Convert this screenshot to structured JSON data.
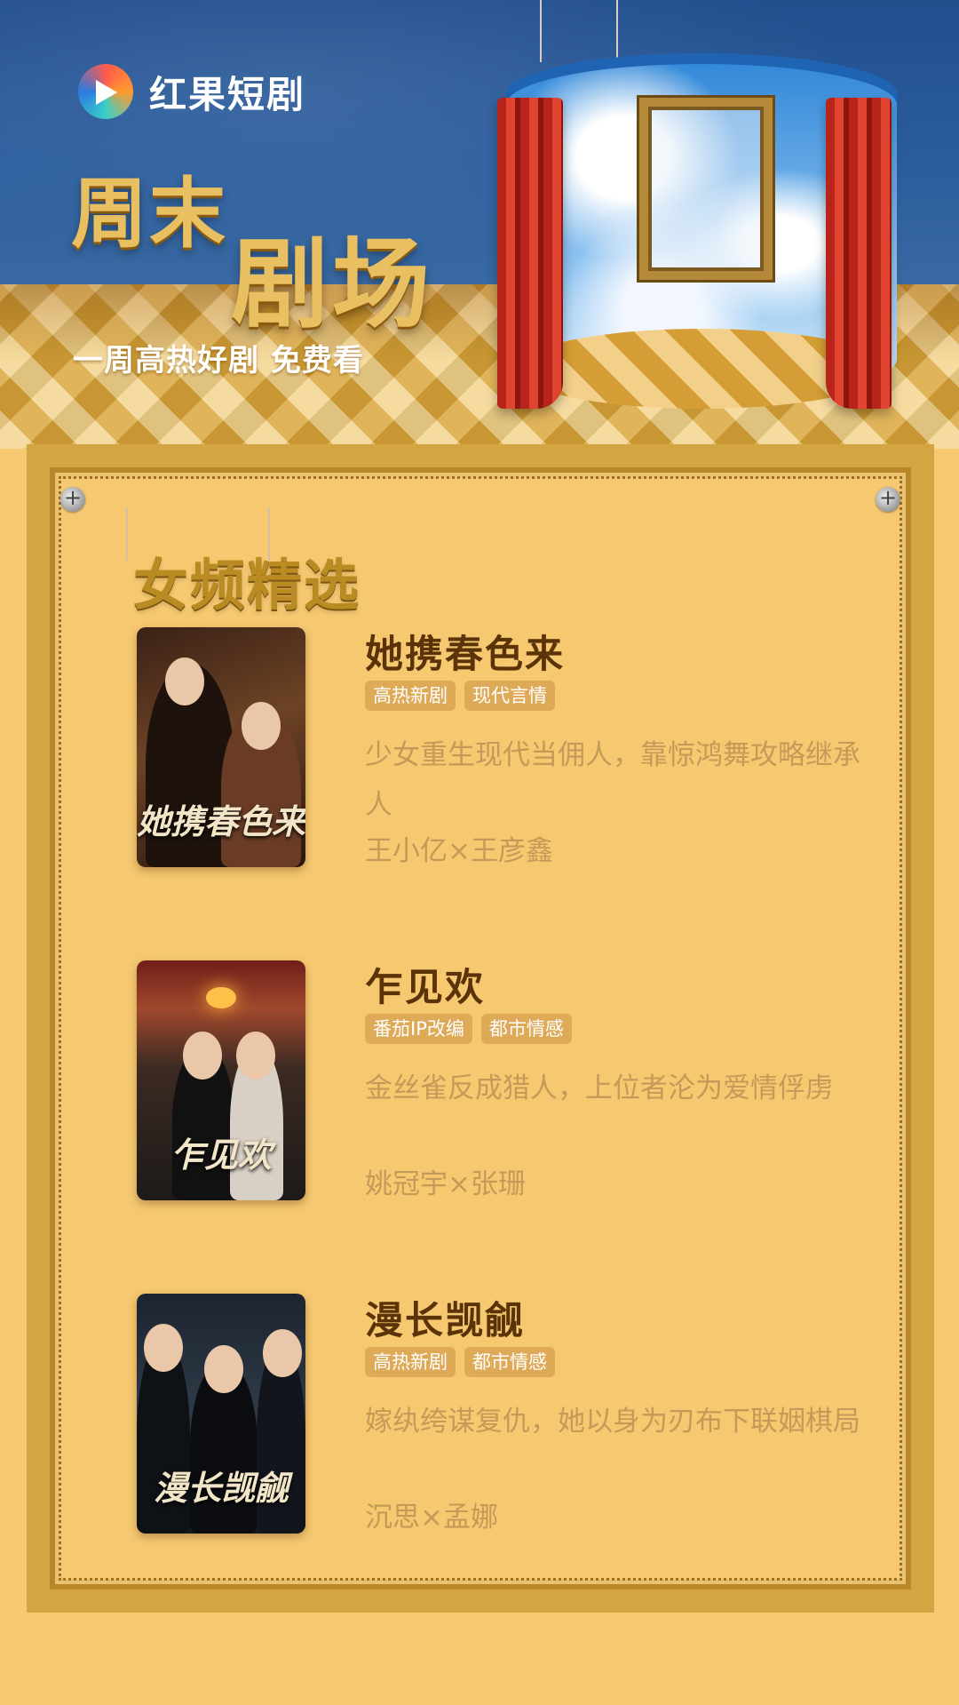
{
  "brand": {
    "name": "红果短剧"
  },
  "hero": {
    "title_part1": "周末",
    "title_part2": "剧场",
    "subtitle": "一周高热好剧  免费看"
  },
  "section": {
    "title": "女频精选"
  },
  "dramas": [
    {
      "title": "她携春色来",
      "tags": [
        "高热新剧",
        "现代言情"
      ],
      "description": "少女重生现代当佣人，靠惊鸿舞攻略继承人",
      "cast": "王小亿×王彦鑫",
      "poster_text": "她携春色来"
    },
    {
      "title": "乍见欢",
      "tags": [
        "番茄IP改编",
        "都市情感"
      ],
      "description": "金丝雀反成猎人，上位者沦为爱情俘虏",
      "cast": "姚冠宇×张珊",
      "poster_text": "乍见欢"
    },
    {
      "title": "漫长觊觎",
      "tags": [
        "高热新剧",
        "都市情感"
      ],
      "description": "嫁纨绔谋复仇，她以身为刃布下联姻棋局",
      "cast": "沉思×孟娜",
      "poster_text": "漫长觊觎"
    }
  ],
  "colors": {
    "sky": "#214f8e",
    "gold_title": "#e9c061",
    "panel_bg": "#f6c971",
    "drama_title": "#5a3309",
    "tag_bg": "#deaa57",
    "body_text": "#c39a58"
  }
}
